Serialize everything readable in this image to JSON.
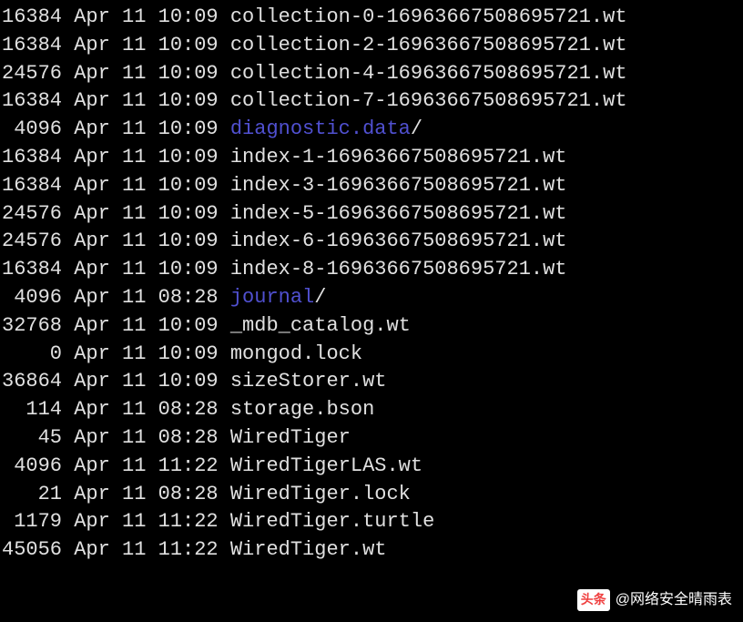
{
  "listing": [
    {
      "size": "16384",
      "month": "Apr",
      "day": "11",
      "time": "10:09",
      "name": "collection-0-16963667508695721.wt",
      "type": "file"
    },
    {
      "size": "16384",
      "month": "Apr",
      "day": "11",
      "time": "10:09",
      "name": "collection-2-16963667508695721.wt",
      "type": "file"
    },
    {
      "size": "24576",
      "month": "Apr",
      "day": "11",
      "time": "10:09",
      "name": "collection-4-16963667508695721.wt",
      "type": "file"
    },
    {
      "size": "16384",
      "month": "Apr",
      "day": "11",
      "time": "10:09",
      "name": "collection-7-16963667508695721.wt",
      "type": "file"
    },
    {
      "size": "4096",
      "month": "Apr",
      "day": "11",
      "time": "10:09",
      "name": "diagnostic.data",
      "type": "dir"
    },
    {
      "size": "16384",
      "month": "Apr",
      "day": "11",
      "time": "10:09",
      "name": "index-1-16963667508695721.wt",
      "type": "file"
    },
    {
      "size": "16384",
      "month": "Apr",
      "day": "11",
      "time": "10:09",
      "name": "index-3-16963667508695721.wt",
      "type": "file"
    },
    {
      "size": "24576",
      "month": "Apr",
      "day": "11",
      "time": "10:09",
      "name": "index-5-16963667508695721.wt",
      "type": "file"
    },
    {
      "size": "24576",
      "month": "Apr",
      "day": "11",
      "time": "10:09",
      "name": "index-6-16963667508695721.wt",
      "type": "file"
    },
    {
      "size": "16384",
      "month": "Apr",
      "day": "11",
      "time": "10:09",
      "name": "index-8-16963667508695721.wt",
      "type": "file"
    },
    {
      "size": "4096",
      "month": "Apr",
      "day": "11",
      "time": "08:28",
      "name": "journal",
      "type": "dir"
    },
    {
      "size": "32768",
      "month": "Apr",
      "day": "11",
      "time": "10:09",
      "name": "_mdb_catalog.wt",
      "type": "file"
    },
    {
      "size": "0",
      "month": "Apr",
      "day": "11",
      "time": "10:09",
      "name": "mongod.lock",
      "type": "file"
    },
    {
      "size": "36864",
      "month": "Apr",
      "day": "11",
      "time": "10:09",
      "name": "sizeStorer.wt",
      "type": "file"
    },
    {
      "size": "114",
      "month": "Apr",
      "day": "11",
      "time": "08:28",
      "name": "storage.bson",
      "type": "file"
    },
    {
      "size": "45",
      "month": "Apr",
      "day": "11",
      "time": "08:28",
      "name": "WiredTiger",
      "type": "file"
    },
    {
      "size": "4096",
      "month": "Apr",
      "day": "11",
      "time": "11:22",
      "name": "WiredTigerLAS.wt",
      "type": "file"
    },
    {
      "size": "21",
      "month": "Apr",
      "day": "11",
      "time": "08:28",
      "name": "WiredTiger.lock",
      "type": "file"
    },
    {
      "size": "1179",
      "month": "Apr",
      "day": "11",
      "time": "11:22",
      "name": "WiredTiger.turtle",
      "type": "file"
    },
    {
      "size": "45056",
      "month": "Apr",
      "day": "11",
      "time": "11:22",
      "name": "WiredTiger.wt",
      "type": "file"
    }
  ],
  "watermark": {
    "logo": "头条",
    "handle": "@网络安全晴雨表"
  }
}
